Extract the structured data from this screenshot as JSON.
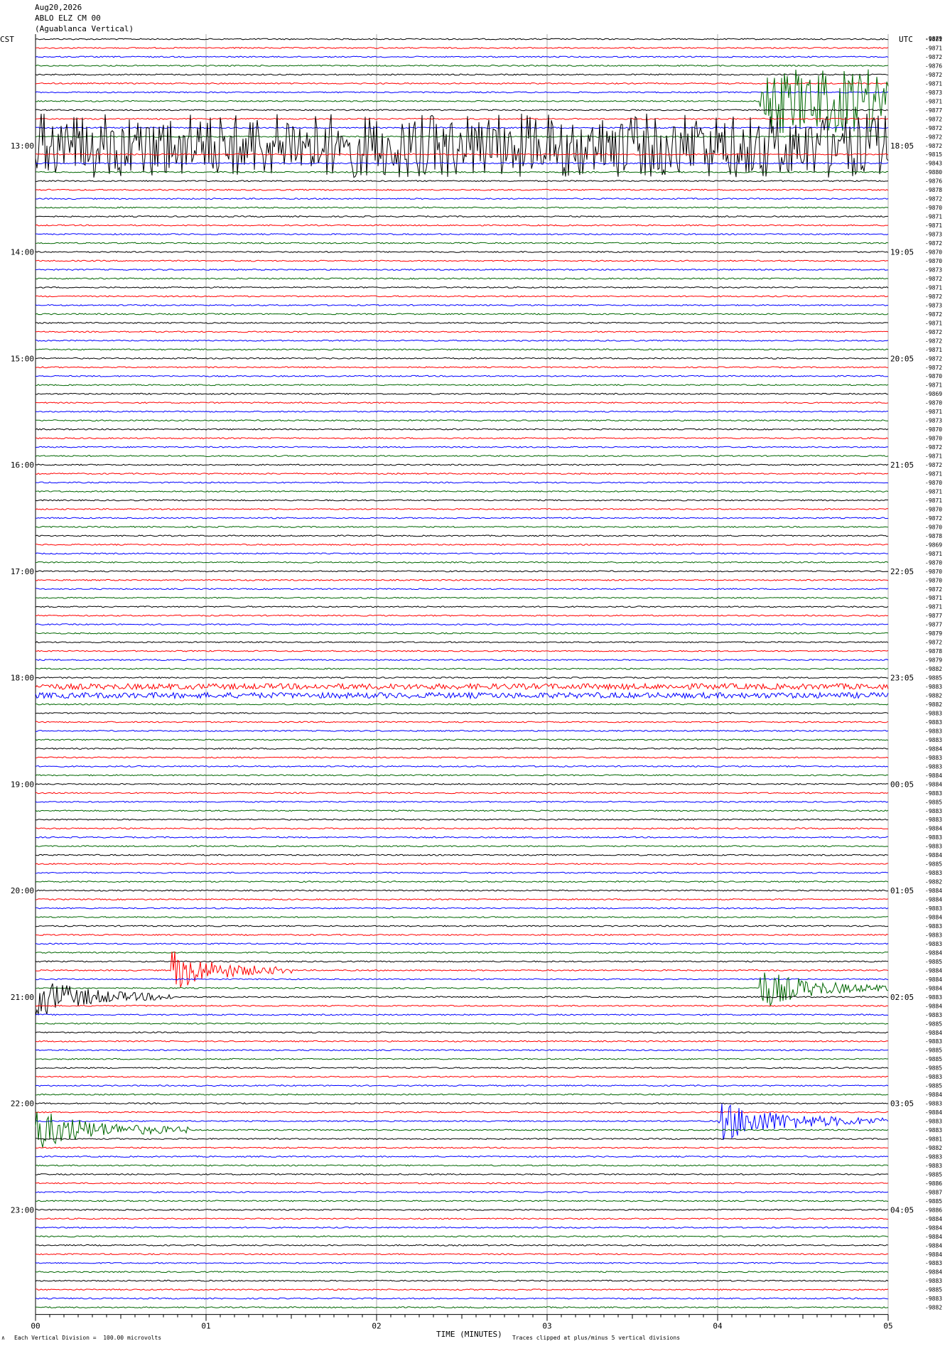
{
  "header": {
    "line1": "Aug20,2026",
    "line2": "ABLO ELZ CM 00",
    "line3": "(Aguablanca Vertical)",
    "left_tz": "CST",
    "right_tz": "UTC",
    "right_top_mark": "-9879"
  },
  "footer": {
    "scale_note": "Each Vertical Division =  100.00 microvolts",
    "xlabel": "TIME (MINUTES)",
    "clip_note": "Traces clipped at plus/minus 5 vertical divisions",
    "corner_mark": "∧"
  },
  "colors": {
    "trace_cycle": [
      "#000000",
      "#ff0000",
      "#0000ff",
      "#006600"
    ],
    "grid": "#9a9a9a",
    "frame": "#000000"
  },
  "chart_data": {
    "type": "line",
    "chart_kind": "helicorder seismogram",
    "x_ticks": [
      "00",
      "01",
      "02",
      "03",
      "04",
      "05"
    ],
    "xlim": [
      0,
      5
    ],
    "x_unit": "minutes",
    "rows": 144,
    "left_time_labels": [
      "13:00",
      "14:00",
      "15:00",
      "16:00",
      "17:00",
      "18:00",
      "19:00",
      "20:00",
      "21:00",
      "22:00",
      "23:00"
    ],
    "right_time_labels": [
      "18:05",
      "19:05",
      "20:05",
      "21:05",
      "22:05",
      "23:05",
      "00:05",
      "01:05",
      "02:05",
      "03:05",
      "04:05"
    ],
    "first_labeled_row": 12,
    "rows_per_hour": 12,
    "right_row_values": [
      "-9881",
      "-9871",
      "-9872",
      "-9876",
      "-9872",
      "-9871",
      "-9873",
      "-9871",
      "-9877",
      "-9872",
      "-9872",
      "-9872",
      "-9872",
      "-9815",
      "-9843",
      "-9880",
      "-9876",
      "-9878",
      "-9872",
      "-9870",
      "-9871",
      "-9871",
      "-9873",
      "-9872",
      "-9870",
      "-9870",
      "-9873",
      "-9872",
      "-9871",
      "-9872",
      "-9873",
      "-9872",
      "-9871",
      "-9872",
      "-9872",
      "-9871",
      "-9872",
      "-9872",
      "-9870",
      "-9871",
      "-9869",
      "-9870",
      "-9871",
      "-9873",
      "-9870",
      "-9870",
      "-9872",
      "-9871",
      "-9872",
      "-9871",
      "-9870",
      "-9871",
      "-9871",
      "-9870",
      "-9872",
      "-9870",
      "-9878",
      "-9869",
      "-9871",
      "-9870",
      "-9870",
      "-9870",
      "-9872",
      "-9871",
      "-9871",
      "-9877",
      "-9877",
      "-9879",
      "-9872",
      "-9878",
      "-9879",
      "-9882",
      "-9885",
      "-9883",
      "-9882",
      "-9882",
      "-9883",
      "-9883",
      "-9883",
      "-9883",
      "-9884",
      "-9883",
      "-9883",
      "-9884",
      "-9884",
      "-9883",
      "-9885",
      "-9883",
      "-9883",
      "-9884",
      "-9883",
      "-9883",
      "-9884",
      "-9885",
      "-9883",
      "-9882",
      "-9884",
      "-9884",
      "-9883",
      "-9884",
      "-9883",
      "-9883",
      "-9883",
      "-9884",
      "-9885",
      "-9884",
      "-9884",
      "-9884",
      "-9883",
      "-9884",
      "-9883",
      "-9885",
      "-9884",
      "-9883",
      "-9885",
      "-9885",
      "-9885",
      "-9883",
      "-9885",
      "-9884",
      "-9883",
      "-9884",
      "-9883",
      "-9883",
      "-9881",
      "-9882",
      "-9883",
      "-9883",
      "-9885",
      "-9886",
      "-9887",
      "-9885",
      "-9886",
      "-9884",
      "-9884",
      "-9884",
      "-9884",
      "-9884",
      "-9883",
      "-9884",
      "-9883",
      "-9885",
      "-9883",
      "-9882",
      "-9884"
    ],
    "events": [
      {
        "row": 12,
        "kind": "clipped burst",
        "x_minutes": [
          0.0,
          5.0
        ],
        "rows_span": 8
      },
      {
        "row": 7,
        "kind": "clipped burst",
        "x_minutes": [
          4.25,
          5.0
        ],
        "rows_span": 10
      },
      {
        "row": 73,
        "kind": "noise",
        "x_minutes": [
          0.0,
          5.0
        ]
      },
      {
        "row": 74,
        "kind": "noise",
        "x_minutes": [
          0.0,
          5.0
        ]
      },
      {
        "row": 105,
        "kind": "quake",
        "x_minutes": [
          0.8,
          1.5
        ]
      },
      {
        "row": 107,
        "kind": "quake",
        "x_minutes": [
          4.25,
          5.0
        ]
      },
      {
        "row": 108,
        "kind": "quake",
        "x_minutes": [
          0.0,
          0.8
        ]
      },
      {
        "row": 123,
        "kind": "quake",
        "x_minutes": [
          0.0,
          0.9
        ]
      },
      {
        "row": 122,
        "kind": "quake",
        "x_minutes": [
          4.0,
          5.0
        ]
      }
    ]
  }
}
